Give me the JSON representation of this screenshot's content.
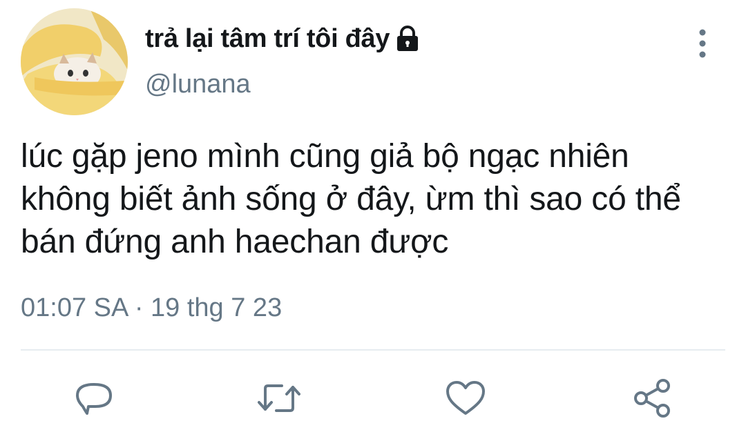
{
  "tweet": {
    "display_name": "trả lại tâm trí tôi đây",
    "handle": "@lunana",
    "text": "lúc gặp jeno mình cũng giả bộ ngạc nhiên không biết ảnh sống ở đây, ừm thì sao có thể bán đứng anh haechan được",
    "time": "01:07 SA",
    "separator": "·",
    "date": "19 thg 7 23"
  },
  "icons": {
    "lock": "lock-icon",
    "more": "vertical-dots-icon",
    "reply": "speech-bubble-icon",
    "retweet": "retweet-icon",
    "like": "heart-icon",
    "share": "share-icon"
  },
  "colors": {
    "text": "#14171a",
    "secondary": "#657786",
    "action_icon": "#657786",
    "divider": "#e6ecf0"
  }
}
